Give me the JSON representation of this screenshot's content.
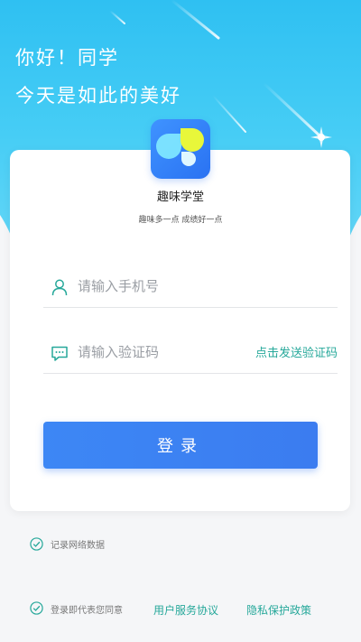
{
  "header": {
    "greeting_line1": "你好！同学",
    "greeting_line2": "今天是如此的美好"
  },
  "app": {
    "name": "趣味学堂",
    "slogan": "趣味多一点   成绩好一点"
  },
  "form": {
    "phone_placeholder": "请输入手机号",
    "code_placeholder": "请输入验证码",
    "send_code_label": "点击发送验证码",
    "login_label": "登录"
  },
  "footer": {
    "record_network_label": "记录网络数据",
    "agree_prefix": "登录即代表您同意",
    "user_agreement": "用户服务协议",
    "privacy_policy": "隐私保护政策"
  },
  "colors": {
    "header_blue": "#2fc0f2",
    "accent_teal": "#26a89a",
    "button_blue": "#3d87f5"
  }
}
